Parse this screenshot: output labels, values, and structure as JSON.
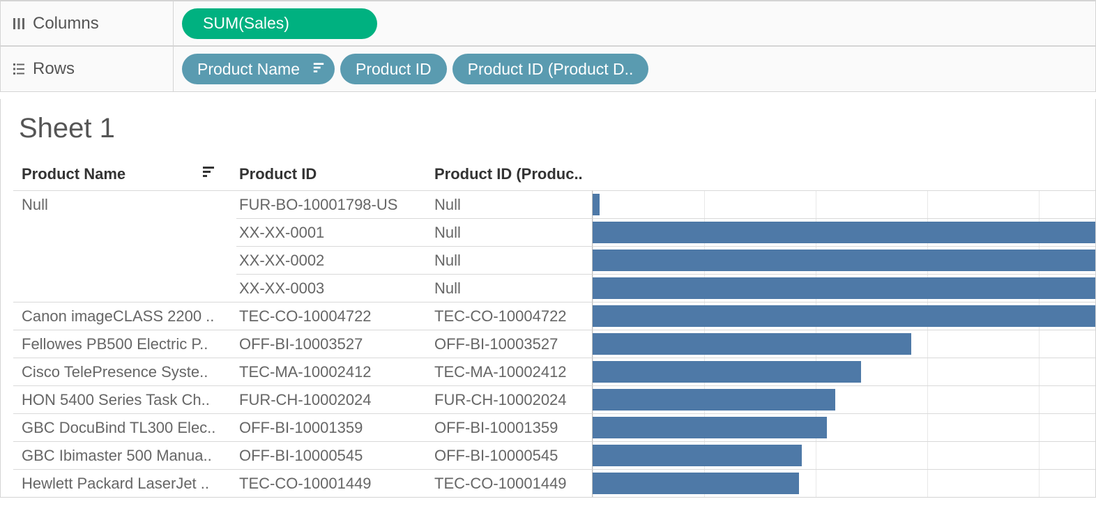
{
  "shelves": {
    "columns_label": "Columns",
    "rows_label": "Rows",
    "columns_pills": [
      {
        "label": "SUM(Sales)",
        "color": "green"
      }
    ],
    "rows_pills": [
      {
        "label": "Product Name",
        "color": "blue",
        "sort": true
      },
      {
        "label": "Product ID",
        "color": "blue"
      },
      {
        "label": "Product ID (Product D..",
        "color": "blue"
      }
    ]
  },
  "sheet": {
    "title": "Sheet 1",
    "headers": {
      "c1": "Product Name",
      "c2": "Product ID",
      "c3": "Product ID (Produc.."
    }
  },
  "chart_data": {
    "type": "bar",
    "title": "Sheet 1",
    "columns": [
      "Product Name",
      "Product ID",
      "Product ID (Produc..",
      "SUM(Sales)"
    ],
    "rows": [
      {
        "product_name": "Null",
        "product_id": "FUR-BO-10001798-US",
        "product_id2": "Null",
        "value": 400,
        "first_of_group": true
      },
      {
        "product_name": "",
        "product_id": "XX-XX-0001",
        "product_id2": "Null",
        "value": 31000,
        "first_of_group": false
      },
      {
        "product_name": "",
        "product_id": "XX-XX-0002",
        "product_id2": "Null",
        "value": 31000,
        "first_of_group": false
      },
      {
        "product_name": "",
        "product_id": "XX-XX-0003",
        "product_id2": "Null",
        "value": 31000,
        "first_of_group": false
      },
      {
        "product_name": "Canon imageCLASS 2200 ..",
        "product_id": "TEC-CO-10004722",
        "product_id2": "TEC-CO-10004722",
        "value": 31000,
        "first_of_group": true
      },
      {
        "product_name": "Fellowes PB500 Electric P..",
        "product_id": "OFF-BI-10003527",
        "product_id2": "OFF-BI-10003527",
        "value": 19000,
        "first_of_group": true
      },
      {
        "product_name": "Cisco TelePresence Syste..",
        "product_id": "TEC-MA-10002412",
        "product_id2": "TEC-MA-10002412",
        "value": 16000,
        "first_of_group": true
      },
      {
        "product_name": "HON 5400 Series Task Ch..",
        "product_id": "FUR-CH-10002024",
        "product_id2": "FUR-CH-10002024",
        "value": 14500,
        "first_of_group": true
      },
      {
        "product_name": "GBC DocuBind TL300 Elec..",
        "product_id": "OFF-BI-10001359",
        "product_id2": "OFF-BI-10001359",
        "value": 14000,
        "first_of_group": true
      },
      {
        "product_name": "GBC Ibimaster 500 Manua..",
        "product_id": "OFF-BI-10000545",
        "product_id2": "OFF-BI-10000545",
        "value": 12500,
        "first_of_group": true
      },
      {
        "product_name": "Hewlett Packard LaserJet ..",
        "product_id": "TEC-CO-10001449",
        "product_id2": "TEC-CO-10001449",
        "value": 12300,
        "first_of_group": true
      }
    ],
    "xmax": 30000
  }
}
